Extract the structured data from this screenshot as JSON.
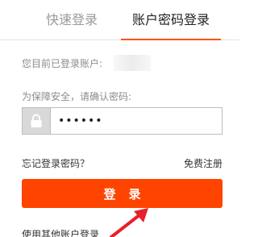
{
  "tabs": {
    "quick_login": "快速登录",
    "account_login": "账户密码登录",
    "active": "account_login"
  },
  "logged_in": {
    "label": "您目前已登录账户:"
  },
  "verify": {
    "label": "为保障安全，请确认密码:"
  },
  "password": {
    "value": "••••••"
  },
  "links": {
    "forgot": "忘记登录密码？",
    "register": "免费注册"
  },
  "login_button": {
    "label": "登录"
  },
  "other_login": {
    "label": "使用其他账户登录"
  },
  "colors": {
    "accent": "#ff5000",
    "button": "#ff4400",
    "annotation_arrow": "#e8202a"
  },
  "icons": {
    "lock": "lock-icon"
  }
}
